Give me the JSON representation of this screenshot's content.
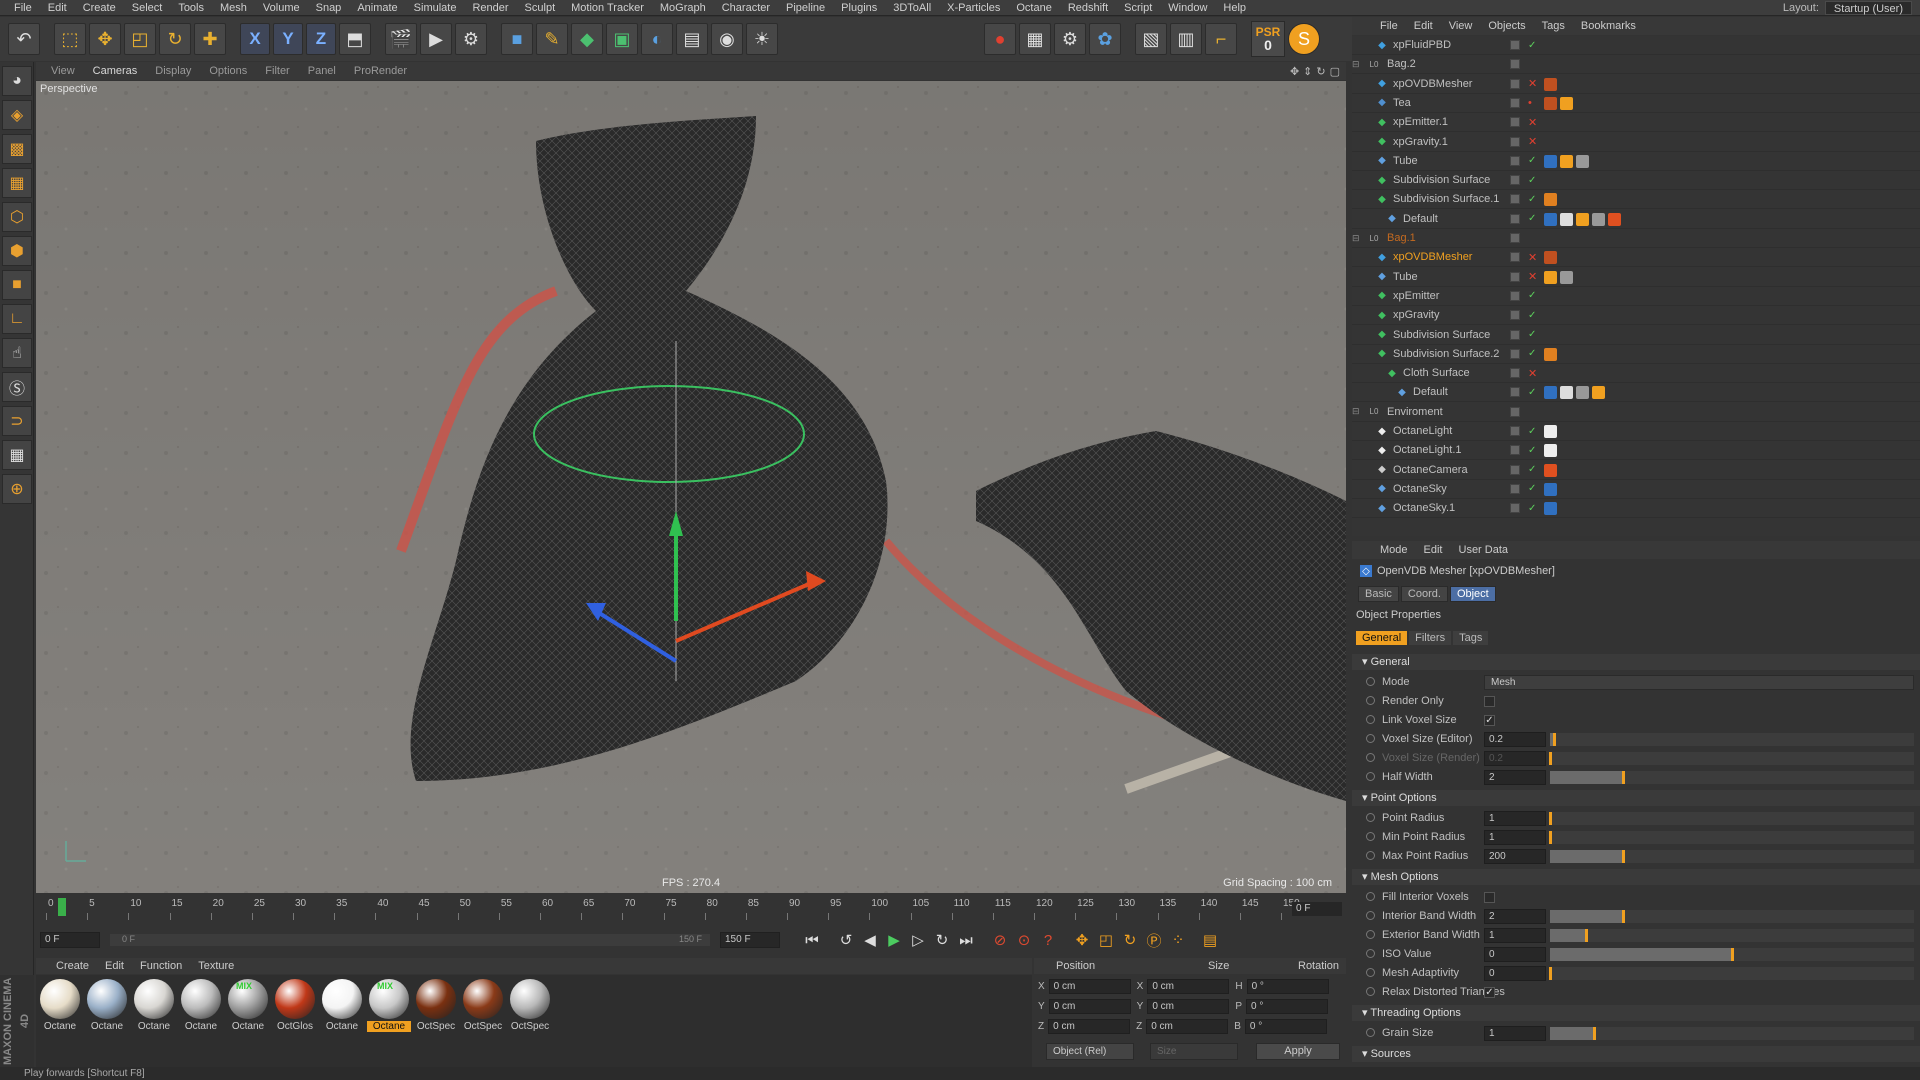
{
  "menubar": {
    "items": [
      "File",
      "Edit",
      "Create",
      "Select",
      "Tools",
      "Mesh",
      "Volume",
      "Snap",
      "Animate",
      "Simulate",
      "Render",
      "Sculpt",
      "Motion Tracker",
      "MoGraph",
      "Character",
      "Pipeline",
      "Plugins",
      "3DToAll",
      "X-Particles",
      "Octane",
      "Redshift",
      "Script",
      "Window",
      "Help"
    ],
    "layout_label": "Layout:",
    "layout_value": "Startup (User)"
  },
  "toolbar": {
    "psr_label": "PSR",
    "psr_value": "0",
    "axis_x": "X",
    "axis_y": "Y",
    "axis_z": "Z"
  },
  "viewport": {
    "menu": [
      "View",
      "Cameras",
      "Display",
      "Options",
      "Filter",
      "Panel",
      "ProRender"
    ],
    "active_menu": "Cameras",
    "camera_label": "Perspective",
    "fps": "FPS : 270.4",
    "grid_spacing": "Grid Spacing : 100 cm"
  },
  "timeline": {
    "ticks": [
      "0",
      "5",
      "10",
      "15",
      "20",
      "25",
      "30",
      "35",
      "40",
      "45",
      "50",
      "55",
      "60",
      "65",
      "70",
      "75",
      "80",
      "85",
      "90",
      "95",
      "100",
      "105",
      "110",
      "115",
      "120",
      "125",
      "130",
      "135",
      "140",
      "145",
      "150"
    ],
    "current_frame": "0 F",
    "start_field": "0 F",
    "range_start": "0 F",
    "range_end": "150 F",
    "end_field": "150 F"
  },
  "materials": {
    "menu": [
      "Create",
      "Edit",
      "Function",
      "Texture"
    ],
    "items": [
      {
        "label": "Octane",
        "color": "#e6dcc8",
        "selected": false
      },
      {
        "label": "Octane",
        "color": "#9ab0c8",
        "selected": false
      },
      {
        "label": "Octane",
        "color": "#d8d6d2",
        "selected": false
      },
      {
        "label": "Octane",
        "color": "#bcbcbc",
        "selected": false
      },
      {
        "label": "Octane",
        "color": "#a0a0a0",
        "selected": false
      },
      {
        "label": "OctGlos",
        "color": "#c03818",
        "selected": false
      },
      {
        "label": "Octane",
        "color": "#f4f4f4",
        "selected": false
      },
      {
        "label": "Octane",
        "color": "#c8c8c8",
        "selected": true
      },
      {
        "label": "OctSpec",
        "color": "#7a3010",
        "selected": false
      },
      {
        "label": "OctSpec",
        "color": "#8a3a18",
        "selected": false
      },
      {
        "label": "OctSpec",
        "color": "#b8b8b8",
        "selected": false
      }
    ],
    "mix_badge": "MIX"
  },
  "coordinates": {
    "headers": [
      "Position",
      "Size",
      "Rotation"
    ],
    "rows": [
      {
        "axis": "X",
        "pos": "0 cm",
        "size_axis": "X",
        "size": "0 cm",
        "rot_axis": "H",
        "rot": "0 °"
      },
      {
        "axis": "Y",
        "pos": "0 cm",
        "size_axis": "Y",
        "size": "0 cm",
        "rot_axis": "P",
        "rot": "0 °"
      },
      {
        "axis": "Z",
        "pos": "0 cm",
        "size_axis": "Z",
        "size": "0 cm",
        "rot_axis": "B",
        "rot": "0 °"
      }
    ],
    "mode": "Object (Rel)",
    "size_mode": "Size",
    "apply": "Apply"
  },
  "brand": "MAXON CINEMA 4D",
  "status": "Play forwards [Shortcut F8]",
  "object_manager": {
    "menu": [
      "File",
      "Edit",
      "View",
      "Objects",
      "Tags",
      "Bookmarks"
    ],
    "rows": [
      {
        "name": "xpFluidPBD",
        "indent": 1,
        "style": "",
        "icon": "#40a0e0",
        "mark": "check",
        "tags": []
      },
      {
        "name": "Bag.2",
        "indent": 0,
        "style": "",
        "icon": "#aaaaaa",
        "mark": "",
        "tags": []
      },
      {
        "name": "xpOVDBMesher",
        "indent": 1,
        "style": "",
        "icon": "#40a0e0",
        "mark": "cross",
        "tags": [
          "#c05020"
        ]
      },
      {
        "name": "Tea",
        "indent": 1,
        "style": "",
        "icon": "#5090d0",
        "mark": "dot",
        "tags": [
          "#c05020",
          "#f0a020"
        ]
      },
      {
        "name": "xpEmitter.1",
        "indent": 1,
        "style": "",
        "icon": "#40c060",
        "mark": "cross",
        "tags": []
      },
      {
        "name": "xpGravity.1",
        "indent": 1,
        "style": "",
        "icon": "#40c060",
        "mark": "cross",
        "tags": []
      },
      {
        "name": "Tube",
        "indent": 1,
        "style": "",
        "icon": "#60a0e0",
        "mark": "check",
        "tags": [
          "#3070c0",
          "#f0a020",
          "#999999"
        ]
      },
      {
        "name": "Subdivision Surface",
        "indent": 1,
        "style": "",
        "icon": "#40c060",
        "mark": "check",
        "tags": []
      },
      {
        "name": "Subdivision Surface.1",
        "indent": 1,
        "style": "",
        "icon": "#40c060",
        "mark": "check",
        "tags": [
          "#e08020"
        ]
      },
      {
        "name": "Default",
        "indent": 2,
        "style": "",
        "icon": "#60a0e0",
        "mark": "check",
        "tags": [
          "#3070c0",
          "#dddddd",
          "#f0a020",
          "#999999",
          "#e05020"
        ]
      },
      {
        "name": "Bag.1",
        "indent": 0,
        "style": "dim",
        "icon": "#aaaaaa",
        "mark": "",
        "tags": []
      },
      {
        "name": "xpOVDBMesher",
        "indent": 1,
        "style": "hl",
        "icon": "#40a0e0",
        "mark": "cross",
        "tags": [
          "#c05020"
        ]
      },
      {
        "name": "Tube",
        "indent": 1,
        "style": "",
        "icon": "#60a0e0",
        "mark": "cross",
        "tags": [
          "#f0a020",
          "#999999"
        ]
      },
      {
        "name": "xpEmitter",
        "indent": 1,
        "style": "",
        "icon": "#40c060",
        "mark": "check",
        "tags": []
      },
      {
        "name": "xpGravity",
        "indent": 1,
        "style": "",
        "icon": "#40c060",
        "mark": "check",
        "tags": []
      },
      {
        "name": "Subdivision Surface",
        "indent": 1,
        "style": "",
        "icon": "#40c060",
        "mark": "check",
        "tags": []
      },
      {
        "name": "Subdivision Surface.2",
        "indent": 1,
        "style": "",
        "icon": "#40c060",
        "mark": "check",
        "tags": [
          "#e08020"
        ]
      },
      {
        "name": "Cloth Surface",
        "indent": 2,
        "style": "",
        "icon": "#40c060",
        "mark": "cross",
        "tags": []
      },
      {
        "name": "Default",
        "indent": 3,
        "style": "",
        "icon": "#60a0e0",
        "mark": "check",
        "tags": [
          "#3070c0",
          "#dddddd",
          "#999999",
          "#f0a020"
        ]
      },
      {
        "name": "Enviroment",
        "indent": 0,
        "style": "",
        "icon": "#aaaaaa",
        "mark": "",
        "tags": []
      },
      {
        "name": "OctaneLight",
        "indent": 1,
        "style": "",
        "icon": "#eeeeee",
        "mark": "check",
        "tags": [
          "#eeeeee"
        ]
      },
      {
        "name": "OctaneLight.1",
        "indent": 1,
        "style": "",
        "icon": "#eeeeee",
        "mark": "check",
        "tags": [
          "#eeeeee"
        ]
      },
      {
        "name": "OctaneCamera",
        "indent": 1,
        "style": "",
        "icon": "#cccccc",
        "mark": "check",
        "tags": [
          "#e05020"
        ]
      },
      {
        "name": "OctaneSky",
        "indent": 1,
        "style": "",
        "icon": "#60a0e0",
        "mark": "check",
        "tags": [
          "#3070c0"
        ]
      },
      {
        "name": "OctaneSky.1",
        "indent": 1,
        "style": "",
        "icon": "#60a0e0",
        "mark": "check",
        "tags": [
          "#3070c0"
        ]
      }
    ]
  },
  "attribute_manager": {
    "menu": [
      "Mode",
      "Edit",
      "User Data"
    ],
    "title": "OpenVDB Mesher [xpOVDBMesher]",
    "tabs": [
      "Basic",
      "Coord.",
      "Object"
    ],
    "active_tab": "Object",
    "section_title": "Object Properties",
    "subtabs": [
      "General",
      "Filters",
      "Tags"
    ],
    "active_subtab": "General",
    "sections": [
      {
        "title": "General",
        "props": [
          {
            "label": "Mode",
            "type": "select",
            "value": "Mesh"
          },
          {
            "label": "Render Only",
            "type": "check",
            "value": ""
          },
          {
            "label": "Link Voxel Size",
            "type": "check",
            "value": "✓"
          },
          {
            "label": "Voxel Size (Editor)",
            "type": "num",
            "value": "0.2",
            "fill": 0.01
          },
          {
            "label": "Voxel Size (Render)",
            "type": "num",
            "value": "0.2",
            "fill": 0.0,
            "disabled": true
          },
          {
            "label": "Half Width",
            "type": "num",
            "value": "2",
            "fill": 0.2
          }
        ]
      },
      {
        "title": "Point Options",
        "props": [
          {
            "label": "Point Radius",
            "type": "num",
            "value": "1",
            "fill": 0.0
          },
          {
            "label": "Min Point Radius",
            "type": "num",
            "value": "1",
            "fill": 0.0
          },
          {
            "label": "Max Point Radius",
            "type": "num",
            "value": "200",
            "fill": 0.2
          }
        ]
      },
      {
        "title": "Mesh Options",
        "props": [
          {
            "label": "Fill Interior Voxels",
            "type": "check",
            "value": ""
          },
          {
            "label": "Interior Band Width",
            "type": "num",
            "value": "2",
            "fill": 0.2
          },
          {
            "label": "Exterior Band Width",
            "type": "num",
            "value": "1",
            "fill": 0.1
          },
          {
            "label": "ISO Value",
            "type": "num",
            "value": "0",
            "fill": 0.5
          },
          {
            "label": "Mesh Adaptivity",
            "type": "num",
            "value": "0",
            "fill": 0.0
          },
          {
            "label": "Relax Distorted Triangles",
            "type": "check",
            "value": "✓"
          }
        ]
      },
      {
        "title": "Threading Options",
        "props": [
          {
            "label": "Grain Size",
            "type": "num",
            "value": "1",
            "fill": 0.12
          }
        ]
      },
      {
        "title": "Sources",
        "props": []
      }
    ]
  }
}
